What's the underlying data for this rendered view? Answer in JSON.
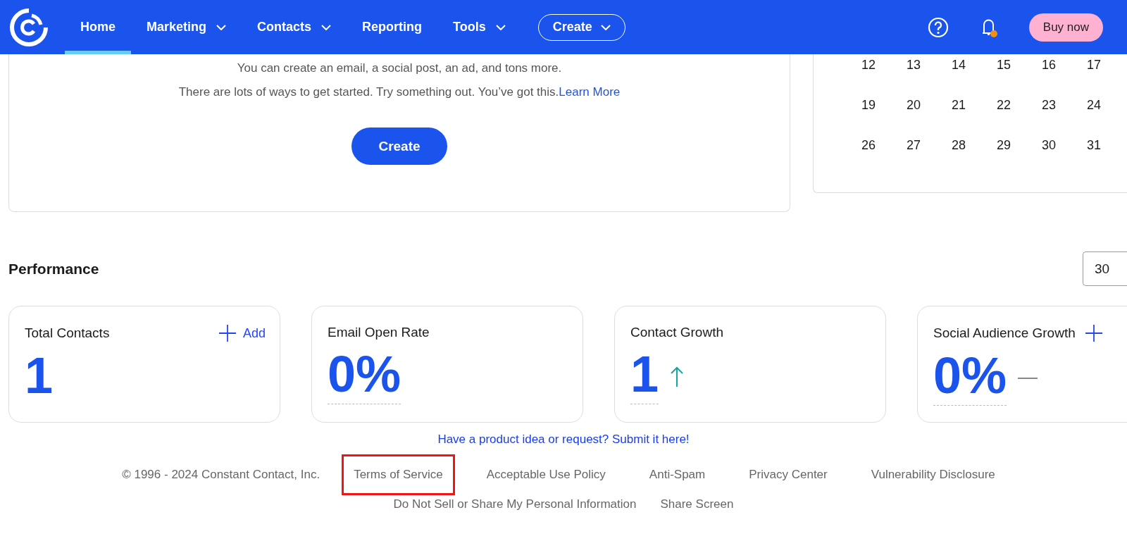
{
  "nav": {
    "items": [
      {
        "label": "Home",
        "dropdown": false,
        "selected": true
      },
      {
        "label": "Marketing",
        "dropdown": true,
        "selected": false
      },
      {
        "label": "Contacts",
        "dropdown": true,
        "selected": false
      },
      {
        "label": "Reporting",
        "dropdown": false,
        "selected": false
      },
      {
        "label": "Tools",
        "dropdown": true,
        "selected": false
      }
    ],
    "create_button": "Create",
    "notification_badge": true,
    "buy_button": "Buy now"
  },
  "intro": {
    "line_1": "You can create an email, a social post, an ad, and tons more.",
    "line_2": "There are lots of ways to get started. Try something out. You’ve got this.",
    "learn_more": "Learn More",
    "create_button": "Create"
  },
  "calendar": {
    "weeks": [
      [
        "12",
        "13",
        "14",
        "15",
        "16",
        "17"
      ],
      [
        "19",
        "20",
        "21",
        "22",
        "23",
        "24"
      ],
      [
        "26",
        "27",
        "28",
        "29",
        "30",
        "31"
      ]
    ]
  },
  "performance": {
    "title": "Performance",
    "period": "30"
  },
  "cards": [
    {
      "title": "Total Contacts",
      "value": "1",
      "add": true,
      "add_label": "Add",
      "kind": "plain",
      "dotted_underline": false
    },
    {
      "title": "Email Open Rate",
      "value": "0%",
      "add": false,
      "kind": "plain",
      "dotted_underline": true
    },
    {
      "title": "Contact Growth",
      "value": "1",
      "add": false,
      "kind": "rising",
      "dotted_underline": true
    },
    {
      "title": "Social Audience Growth",
      "value": "0%",
      "add": true,
      "kind": "flat",
      "dotted_underline": true
    }
  ],
  "footer": {
    "idea_link": "Have a product idea or request? Submit it here!",
    "copyright": "© 1996 - 2024 Constant Contact, Inc.",
    "links": [
      {
        "label": "Terms of Service",
        "highlighted": true
      },
      {
        "label": "Acceptable Use Policy",
        "highlighted": false
      },
      {
        "label": "Anti-Spam",
        "highlighted": false
      },
      {
        "label": "Privacy Center",
        "highlighted": false
      },
      {
        "label": "Vulnerability Disclosure",
        "highlighted": false
      }
    ],
    "links_2": [
      {
        "label": "Do Not Sell or Share My Personal Information",
        "highlighted": false
      },
      {
        "label": "Share Screen",
        "highlighted": false
      }
    ]
  }
}
